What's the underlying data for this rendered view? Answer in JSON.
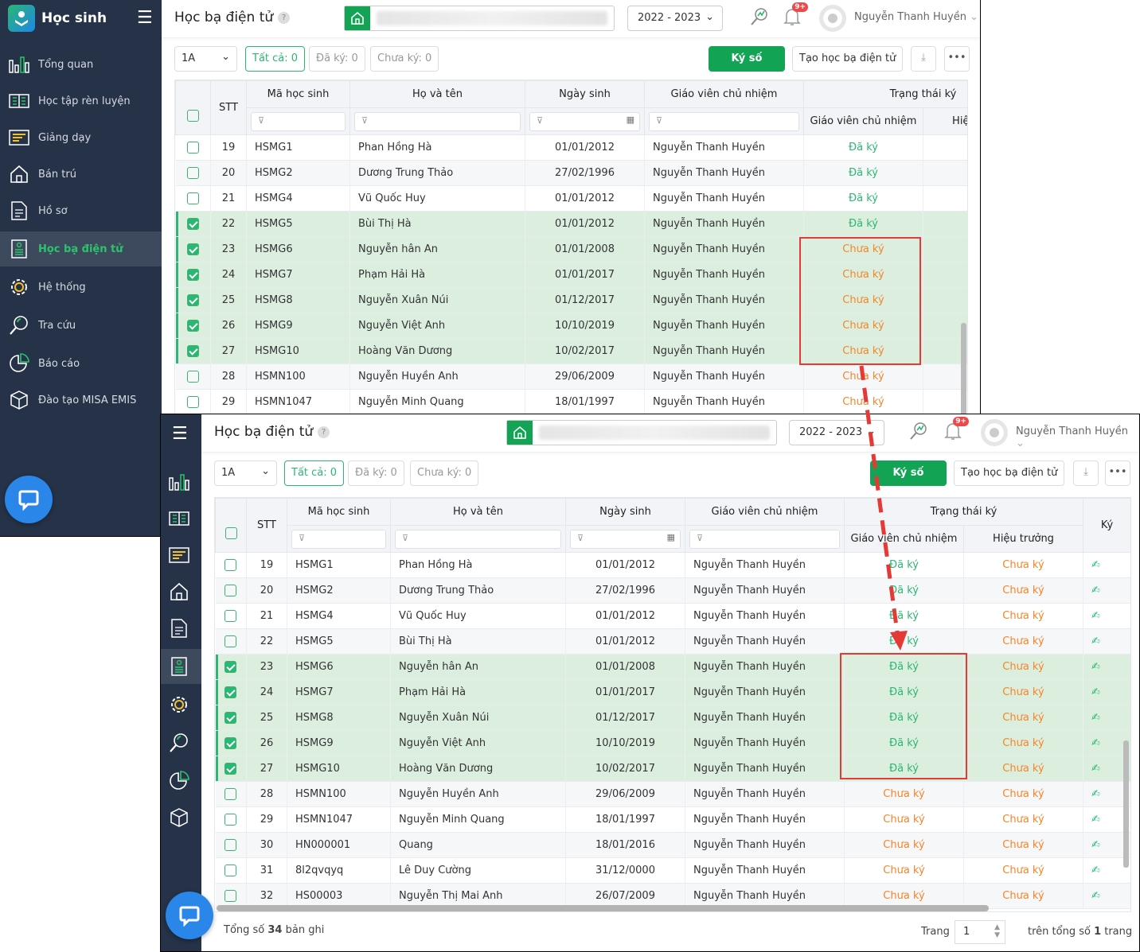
{
  "app": {
    "name": "Học sinh",
    "page_title": "Học bạ điện tử",
    "help": "?"
  },
  "sidebar": {
    "items": [
      {
        "label": "Tổng quan",
        "icon": "chart-bars-icon"
      },
      {
        "label": "Học tập rèn luyện",
        "icon": "book-icon"
      },
      {
        "label": "Giảng dạy",
        "icon": "board-icon"
      },
      {
        "label": "Bán trú",
        "icon": "home-icon"
      },
      {
        "label": "Hồ sơ",
        "icon": "document-icon"
      },
      {
        "label": "Học bạ điện tử",
        "icon": "record-icon",
        "active": true
      },
      {
        "label": "Hệ thống",
        "icon": "gear-icon"
      },
      {
        "label": "Tra cứu",
        "icon": "search-icon"
      },
      {
        "label": "Báo cáo",
        "icon": "pie-chart-icon"
      },
      {
        "label": "Đào tạo MISA EMIS",
        "icon": "cube-icon"
      }
    ]
  },
  "header": {
    "school_year": "2022 - 2023",
    "notifications": "9+",
    "user": "Nguyễn Thanh Huyền"
  },
  "toolbar": {
    "class": "1A",
    "all": "Tất cả: 0",
    "signed": "Đã ký: 0",
    "unsigned": "Chưa ký: 0",
    "sign": "Ký số",
    "create": "Tạo học bạ điện tử"
  },
  "table": {
    "headers": {
      "stt": "STT",
      "code": "Mã học sinh",
      "name": "Họ và tên",
      "dob": "Ngày sinh",
      "teacher": "Giáo viên chủ nhiệm",
      "status": "Trạng thái ký",
      "status_teacher": "Giáo viên chủ nhiệm",
      "status_principal": "Hiệu trưởng",
      "sign": "Ký"
    },
    "status_labels": {
      "signed": "Đã ký",
      "unsigned": "Chưa ký"
    },
    "rows": [
      {
        "stt": "19",
        "code": "HSMG1",
        "name": "Phan Hồng Hà",
        "dob": "01/01/2012",
        "teacher": "Nguyễn Thanh Huyền"
      },
      {
        "stt": "20",
        "code": "HSMG2",
        "name": "Dương Trung Thảo",
        "dob": "27/02/1996",
        "teacher": "Nguyễn Thanh Huyền"
      },
      {
        "stt": "21",
        "code": "HSMG4",
        "name": "Vũ Quốc Huy",
        "dob": "01/01/2012",
        "teacher": "Nguyễn Thanh Huyền"
      },
      {
        "stt": "22",
        "code": "HSMG5",
        "name": "Bùi Thị Hà",
        "dob": "01/01/2012",
        "teacher": "Nguyễn Thanh Huyền"
      },
      {
        "stt": "23",
        "code": "HSMG6",
        "name": "Nguyễn hân An",
        "dob": "01/01/2008",
        "teacher": "Nguyễn Thanh Huyền"
      },
      {
        "stt": "24",
        "code": "HSMG7",
        "name": "Phạm Hải Hà",
        "dob": "01/01/2017",
        "teacher": "Nguyễn Thanh Huyền"
      },
      {
        "stt": "25",
        "code": "HSMG8",
        "name": "Nguyễn Xuân Núi",
        "dob": "01/12/2017",
        "teacher": "Nguyễn Thanh Huyền"
      },
      {
        "stt": "26",
        "code": "HSMG9",
        "name": "Nguyễn Việt Anh",
        "dob": "10/10/2019",
        "teacher": "Nguyễn Thanh Huyền"
      },
      {
        "stt": "27",
        "code": "HSMG10",
        "name": "Hoàng Văn Dương",
        "dob": "10/02/2017",
        "teacher": "Nguyễn Thanh Huyền"
      },
      {
        "stt": "28",
        "code": "HSMN100",
        "name": "Nguyễn Huyền Anh",
        "dob": "29/06/2009",
        "teacher": "Nguyễn Thanh Huyền"
      },
      {
        "stt": "29",
        "code": "HSMN1047",
        "name": "Nguyễn Minh Quang",
        "dob": "18/01/1997",
        "teacher": "Nguyễn Thanh Huyền"
      },
      {
        "stt": "30",
        "code": "HN000001",
        "name": "Quang",
        "dob": "18/01/2016",
        "teacher": "Nguyễn Thanh Huyền"
      },
      {
        "stt": "31",
        "code": "8l2qvqyq",
        "name": "Lê Duy Cường",
        "dob": "31/12/0000",
        "teacher": "Nguyễn Thanh Huyền"
      },
      {
        "stt": "32",
        "code": "HS00003",
        "name": "Nguyễn Thị Mai Anh",
        "dob": "26/07/2009",
        "teacher": "Nguyễn Thanh Huyền"
      }
    ]
  },
  "before": {
    "row_count": 11,
    "checked": [
      "22",
      "23",
      "24",
      "25",
      "26",
      "27"
    ],
    "teacher_signed": [
      "19",
      "20",
      "21",
      "22"
    ]
  },
  "after": {
    "row_count": 14,
    "checked": [
      "23",
      "24",
      "25",
      "26",
      "27"
    ],
    "teacher_signed": [
      "19",
      "20",
      "21",
      "22",
      "23",
      "24",
      "25",
      "26",
      "27"
    ]
  },
  "footer": {
    "total_prefix": "Tổng số ",
    "total": "34",
    "total_suffix": " bản ghi",
    "page_label": "Trang",
    "page": "1",
    "of_prefix": "trên tổng số ",
    "pages": "1",
    "of_suffix": " trang"
  },
  "colors": {
    "accent": "#12a454",
    "sidebar": "#253247",
    "signed": "#2bb673",
    "unsigned": "#f5852a",
    "highlight": "#e53935"
  }
}
